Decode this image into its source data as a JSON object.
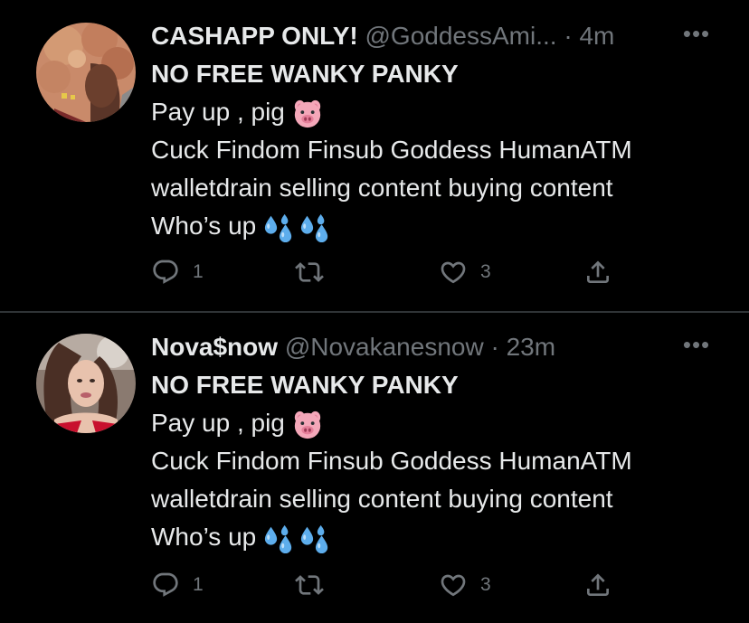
{
  "colors": {
    "background": "#000000",
    "text_primary": "#e7e9ea",
    "text_secondary": "#71767b",
    "divider": "#2f3336"
  },
  "tweets": [
    {
      "display_name": "CASHAPP ONLY!",
      "handle": "@GoddessAmi...",
      "separator": "·",
      "time": "4m",
      "more_label": "•••",
      "title_line": "NO FREE WANKY PANKY",
      "line_pay": "Pay up , pig",
      "line_tags": "Cuck Findom Finsub Goddess HumanATM",
      "line_tags2": "walletdrain selling content buying content",
      "line_whos": "Who’s up",
      "icons": {
        "pig": "pig-face-emoji",
        "drops": "sweat-droplets-emoji",
        "reply": "reply-icon",
        "retweet": "retweet-icon",
        "like": "heart-icon",
        "share": "share-icon"
      },
      "reply_count": "1",
      "retweet_count": "",
      "like_count": "3"
    },
    {
      "display_name": "Nova$now",
      "handle": "@Novakanesnow",
      "separator": "·",
      "time": "23m",
      "more_label": "•••",
      "title_line": "NO FREE WANKY PANKY",
      "line_pay": "Pay up , pig",
      "line_tags": "Cuck Findom Finsub Goddess HumanATM",
      "line_tags2": "walletdrain selling content buying content",
      "line_whos": "Who’s up",
      "icons": {
        "pig": "pig-face-emoji",
        "drops": "sweat-droplets-emoji",
        "reply": "reply-icon",
        "retweet": "retweet-icon",
        "like": "heart-icon",
        "share": "share-icon"
      },
      "reply_count": "1",
      "retweet_count": "",
      "like_count": "3"
    }
  ]
}
